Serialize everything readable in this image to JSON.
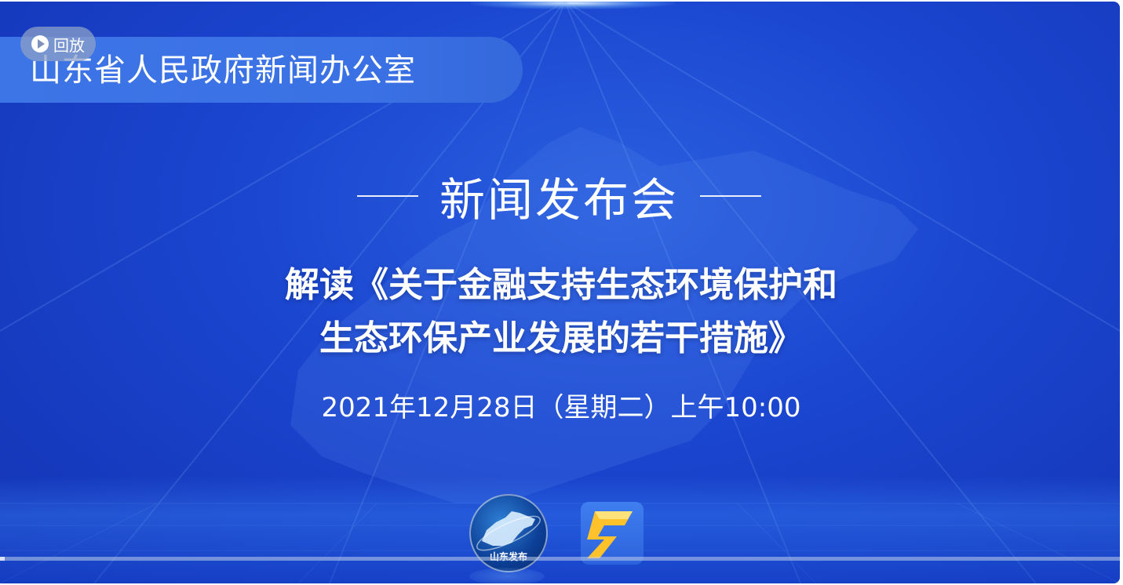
{
  "player": {
    "org_title": "山东省人民政府新闻办公室",
    "replay_label": "回放",
    "press_title": "新闻发布会",
    "headline_line1": "解读《关于金融支持生态环境保护和",
    "headline_line2": "生态环保产业发展的若干措施》",
    "datetime": "2021年12月28日（星期二）上午10:00",
    "logo_circle_text": "山东发布",
    "progress_fraction": 0.004
  },
  "colors": {
    "background": "#1a45cf",
    "banner": "#3d74e6",
    "text": "#ffffff"
  }
}
